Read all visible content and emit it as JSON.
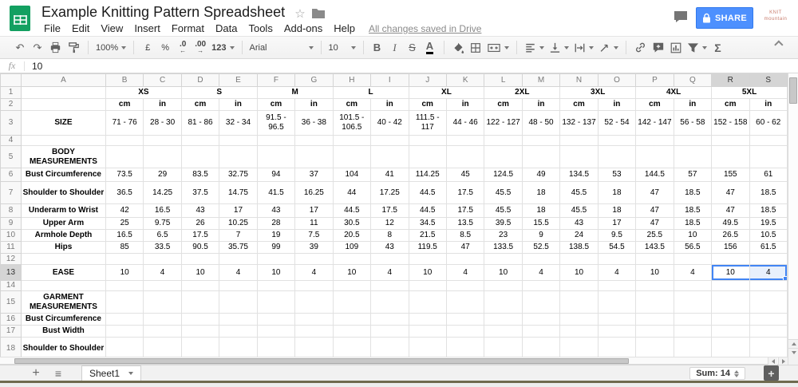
{
  "titlebar": {
    "title": "Example Knitting Pattern Spreadsheet",
    "menu": [
      "File",
      "Edit",
      "View",
      "Insert",
      "Format",
      "Data",
      "Tools",
      "Add-ons",
      "Help"
    ],
    "saved_status": "All changes saved in Drive",
    "share_label": "SHARE",
    "watermark_lines": [
      "KNIT",
      "mountain"
    ]
  },
  "toolbar": {
    "zoom": "100%",
    "currency": "£",
    "percent": "%",
    "decrease_decimal": ".0",
    "increase_decimal": ".00",
    "more_formats": "123",
    "font_name": "Arial",
    "font_size": "10",
    "bold": "B",
    "italic": "I",
    "strikethrough": "S",
    "text_color": "A",
    "functions": "Σ"
  },
  "icons": {
    "undo": "↶",
    "redo": "↷",
    "star": "☆",
    "all-sheets": "≡",
    "add-sheet": "+",
    "dec-arrow": "←",
    "inc-arrow": "→",
    "explore-plus": "+"
  },
  "formula_bar": {
    "fx": "fx",
    "value": "10"
  },
  "sheet": {
    "columns": [
      "A",
      "B",
      "C",
      "D",
      "E",
      "F",
      "G",
      "H",
      "I",
      "J",
      "K",
      "L",
      "M",
      "N",
      "O",
      "P",
      "Q",
      "R",
      "S"
    ],
    "selection": {
      "row": 13,
      "cols": [
        "R",
        "S"
      ],
      "active_col": "R"
    },
    "size_groups": [
      "XS",
      "S",
      "M",
      "L",
      "XL",
      "2XL",
      "3XL",
      "4XL",
      "5XL"
    ],
    "rows": [
      {
        "n": 1,
        "kind": "sizes",
        "label": ""
      },
      {
        "n": 2,
        "kind": "units",
        "label": "",
        "values": [
          "cm",
          "in",
          "cm",
          "in",
          "cm",
          "in",
          "cm",
          "in",
          "cm",
          "in",
          "cm",
          "in",
          "cm",
          "in",
          "cm",
          "in",
          "cm",
          "in"
        ]
      },
      {
        "n": 3,
        "kind": "data",
        "label": "SIZE",
        "values": [
          "71 - 76",
          "28 - 30",
          "81 - 86",
          "32 - 34",
          "91.5 - 96.5",
          "36 - 38",
          "101.5 - 106.5",
          "40 - 42",
          "111.5 - 117",
          "44 - 46",
          "122 - 127",
          "48 - 50",
          "132 - 137",
          "52 - 54",
          "142 - 147",
          "56 - 58",
          "152 - 158",
          "60 - 62"
        ]
      },
      {
        "n": 4,
        "kind": "empty",
        "label": "",
        "values": []
      },
      {
        "n": 5,
        "kind": "section",
        "label": "BODY MEASUREMENTS",
        "values": []
      },
      {
        "n": 6,
        "kind": "data",
        "label": "Bust Circumference",
        "values": [
          "73.5",
          "29",
          "83.5",
          "32.75",
          "94",
          "37",
          "104",
          "41",
          "114.25",
          "45",
          "124.5",
          "49",
          "134.5",
          "53",
          "144.5",
          "57",
          "155",
          "61"
        ]
      },
      {
        "n": 7,
        "kind": "data",
        "label": "Shoulder to Shoulder",
        "values": [
          "36.5",
          "14.25",
          "37.5",
          "14.75",
          "41.5",
          "16.25",
          "44",
          "17.25",
          "44.5",
          "17.5",
          "45.5",
          "18",
          "45.5",
          "18",
          "47",
          "18.5",
          "47",
          "18.5"
        ]
      },
      {
        "n": 8,
        "kind": "data",
        "label": "Underarm to Wrist",
        "values": [
          "42",
          "16.5",
          "43",
          "17",
          "43",
          "17",
          "44.5",
          "17.5",
          "44.5",
          "17.5",
          "45.5",
          "18",
          "45.5",
          "18",
          "47",
          "18.5",
          "47",
          "18.5"
        ]
      },
      {
        "n": 9,
        "kind": "data",
        "label": "Upper Arm",
        "values": [
          "25",
          "9.75",
          "26",
          "10.25",
          "28",
          "11",
          "30.5",
          "12",
          "34.5",
          "13.5",
          "39.5",
          "15.5",
          "43",
          "17",
          "47",
          "18.5",
          "49.5",
          "19.5"
        ]
      },
      {
        "n": 10,
        "kind": "data",
        "label": "Armhole Depth",
        "values": [
          "16.5",
          "6.5",
          "17.5",
          "7",
          "19",
          "7.5",
          "20.5",
          "8",
          "21.5",
          "8.5",
          "23",
          "9",
          "24",
          "9.5",
          "25.5",
          "10",
          "26.5",
          "10.5"
        ]
      },
      {
        "n": 11,
        "kind": "data",
        "label": "Hips",
        "values": [
          "85",
          "33.5",
          "90.5",
          "35.75",
          "99",
          "39",
          "109",
          "43",
          "119.5",
          "47",
          "133.5",
          "52.5",
          "138.5",
          "54.5",
          "143.5",
          "56.5",
          "156",
          "61.5"
        ]
      },
      {
        "n": 12,
        "kind": "empty",
        "label": "",
        "values": []
      },
      {
        "n": 13,
        "kind": "data",
        "label": "EASE",
        "values": [
          "10",
          "4",
          "10",
          "4",
          "10",
          "4",
          "10",
          "4",
          "10",
          "4",
          "10",
          "4",
          "10",
          "4",
          "10",
          "4",
          "10",
          "4"
        ]
      },
      {
        "n": 14,
        "kind": "empty",
        "label": "",
        "values": []
      },
      {
        "n": 15,
        "kind": "section",
        "label": "GARMENT MEASUREMENTS",
        "values": []
      },
      {
        "n": 16,
        "kind": "data",
        "label": "Bust Circumference",
        "values": []
      },
      {
        "n": 17,
        "kind": "data",
        "label": "Bust Width",
        "values": []
      },
      {
        "n": 18,
        "kind": "data",
        "label": "Shoulder to Shoulder",
        "values": []
      }
    ]
  },
  "bottombar": {
    "sheet_tab": "Sheet1",
    "sum_label": "Sum: 14"
  }
}
